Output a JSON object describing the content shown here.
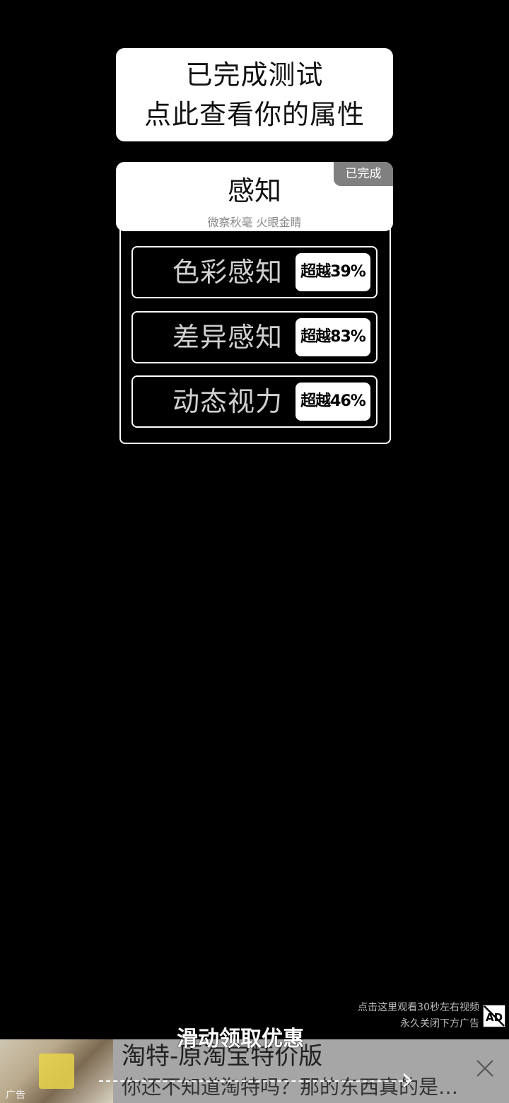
{
  "result_card": {
    "line1": "已完成测试",
    "line2": "点此查看你的属性"
  },
  "category": {
    "title": "感知",
    "subtitle": "微察秋毫 火眼金睛",
    "badge": "已完成"
  },
  "stats": [
    {
      "label": "色彩感知",
      "value": "超越39%",
      "percentile": 39
    },
    {
      "label": "差异感知",
      "value": "超越83%",
      "percentile": 83
    },
    {
      "label": "动态视力",
      "value": "超越46%",
      "percentile": 46
    }
  ],
  "ad": {
    "hint_line1": "点击这里观看30秒左右视频",
    "hint_line2": "永久关闭下方广告",
    "overlay_text": "滑动领取优惠",
    "title": "淘特-原淘宝特价版",
    "description": "你还不知道淘特吗？那的东西真的是…",
    "label": "广告",
    "close_icon": "close-icon",
    "ad_icon": "ad-block-icon"
  }
}
